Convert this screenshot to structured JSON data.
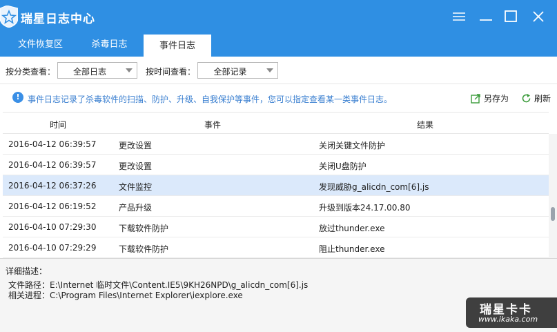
{
  "app": {
    "title": "瑞星日志中心"
  },
  "tabs": [
    {
      "label": "文件恢复区",
      "active": false
    },
    {
      "label": "杀毒日志",
      "active": false
    },
    {
      "label": "事件日志",
      "active": true
    }
  ],
  "filters": {
    "category_label": "按分类查看：",
    "category_value": "全部日志",
    "time_label": "按时间查看：",
    "time_value": "全部记录"
  },
  "info": {
    "text": "事件日志记录了杀毒软件的扫描、防护、升级、自我保护等事件，您可以指定查看某一类事件日志。",
    "save_as": "另存为",
    "refresh": "刷新"
  },
  "table": {
    "columns": [
      "时间",
      "事件",
      "结果"
    ],
    "rows": [
      {
        "time": "2016-04-12 06:39:57",
        "event": "更改设置",
        "result": "关闭关键文件防护",
        "selected": false
      },
      {
        "time": "2016-04-12 06:39:57",
        "event": "更改设置",
        "result": "关闭U盘防护",
        "selected": false
      },
      {
        "time": "2016-04-12 06:37:26",
        "event": "文件监控",
        "result": "发现威胁g_alicdn_com[6].js",
        "selected": true
      },
      {
        "time": "2016-04-12 06:19:52",
        "event": "产品升级",
        "result": "升级到版本24.17.00.80",
        "selected": false
      },
      {
        "time": "2016-04-10 07:29:30",
        "event": "下载软件防护",
        "result": "放过thunder.exe",
        "selected": false
      },
      {
        "time": "2016-04-10 07:29:29",
        "event": "下载软件防护",
        "result": "阻止thunder.exe",
        "selected": false
      }
    ]
  },
  "detail": {
    "title": "详细描述：",
    "path": "文件路径：E:\\Internet 临时文件\\Content.IE5\\9KH26NPD\\g_alicdn_com[6].js",
    "process": "相关进程：C:\\Program Files\\Internet Explorer\\iexplore.exe"
  },
  "watermark": {
    "brand": "瑞星卡卡",
    "url": "www.ikaka.com"
  },
  "colors": {
    "accent": "#2f8fe3",
    "selected_row": "#dbe9fb",
    "info_text": "#3a7fd0"
  }
}
